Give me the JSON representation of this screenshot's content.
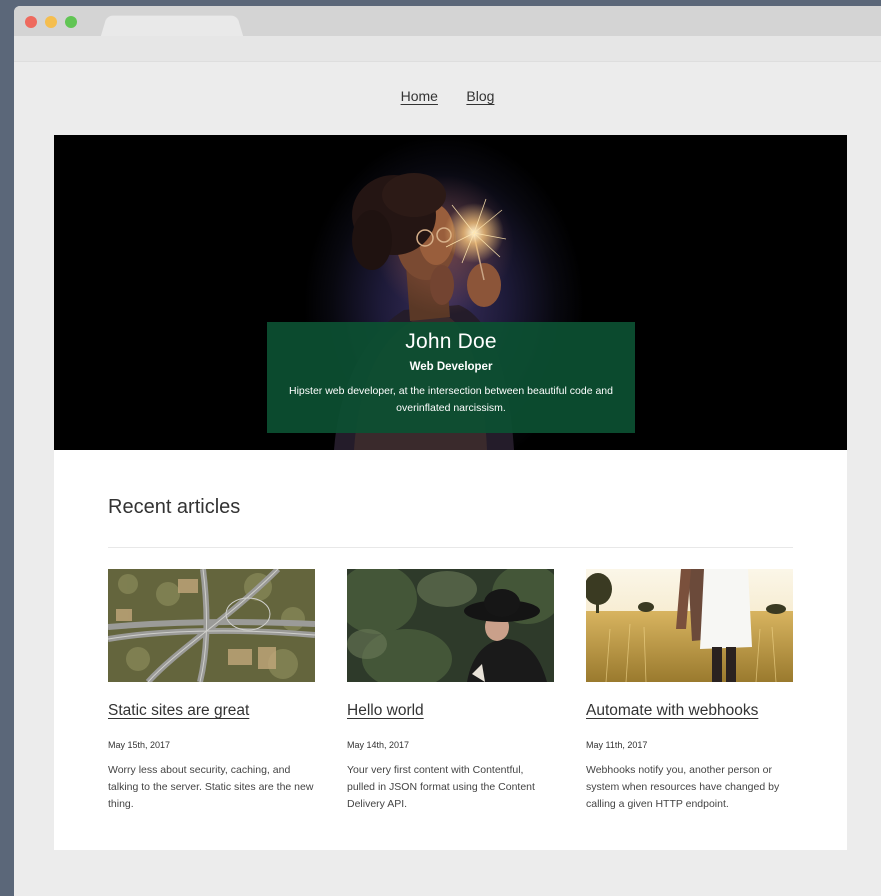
{
  "nav": {
    "items": [
      {
        "label": "Home"
      },
      {
        "label": "Blog"
      }
    ]
  },
  "hero": {
    "name": "John Doe",
    "role": "Web Developer",
    "description": "Hipster web developer, at the intersection between beautiful code and overinflated narcissism.",
    "card_color": "#0c5032"
  },
  "recent": {
    "title": "Recent articles",
    "articles": [
      {
        "title": "Static sites are great",
        "date": "May 15th, 2017",
        "description": "Worry less about security, caching, and talking to the server. Static sites are the new thing."
      },
      {
        "title": "Hello world",
        "date": "May 14th, 2017",
        "description": "Your very first content with Contentful, pulled in JSON format using the Content Delivery API."
      },
      {
        "title": "Automate with webhooks",
        "date": "May 11th, 2017",
        "description": "Webhooks notify you, another person or system when resources have changed by calling a given HTTP endpoint."
      }
    ]
  }
}
